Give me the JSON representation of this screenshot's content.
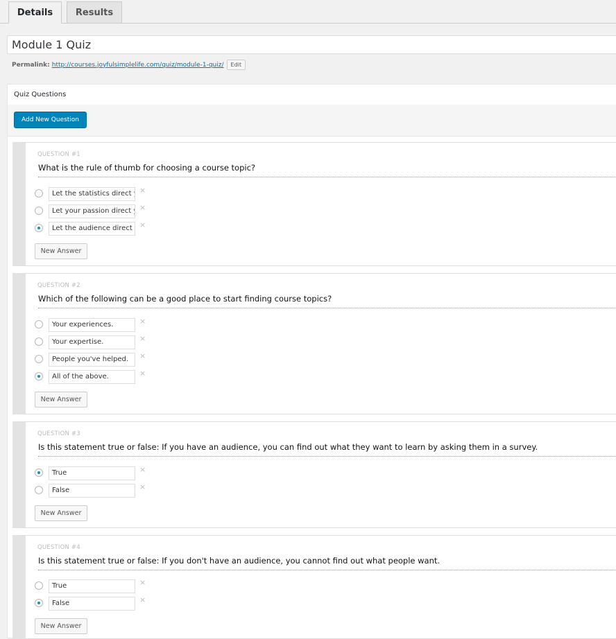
{
  "tabs": {
    "details": "Details",
    "results": "Results"
  },
  "title": "Module 1 Quiz",
  "permalink": {
    "label": "Permalink:",
    "url": "http://courses.joyfulsimplelife.com/quiz/module-1-quiz/",
    "edit": "Edit"
  },
  "quiz_questions": {
    "heading": "Quiz Questions",
    "add_button": "Add New Question",
    "new_answer_label": "New Answer",
    "delete_symbol": "×"
  },
  "questions": [
    {
      "number": "QUESTION #1",
      "text": "What is the rule of thumb for choosing a course topic?",
      "answers": [
        {
          "value": "Let the statistics direct y",
          "selected": false
        },
        {
          "value": "Let your passion direct y",
          "selected": false
        },
        {
          "value": "Let the audience direct",
          "selected": true
        }
      ]
    },
    {
      "number": "QUESTION #2",
      "text": "Which of the following can be a good place to start finding course topics?",
      "answers": [
        {
          "value": "Your experiences.",
          "selected": false
        },
        {
          "value": "Your expertise.",
          "selected": false
        },
        {
          "value": "People you've helped.",
          "selected": false
        },
        {
          "value": "All of the above.",
          "selected": true
        }
      ]
    },
    {
      "number": "QUESTION #3",
      "text": "Is this statement true or false: If you have an audience, you can find out what they want to learn by asking them in a survey.",
      "answers": [
        {
          "value": "True",
          "selected": true
        },
        {
          "value": "False",
          "selected": false
        }
      ]
    },
    {
      "number": "QUESTION #4",
      "text": "Is this statement true or false: If you don't have an audience, you cannot find out what people want.",
      "answers": [
        {
          "value": "True",
          "selected": false
        },
        {
          "value": "False",
          "selected": true
        }
      ]
    }
  ]
}
